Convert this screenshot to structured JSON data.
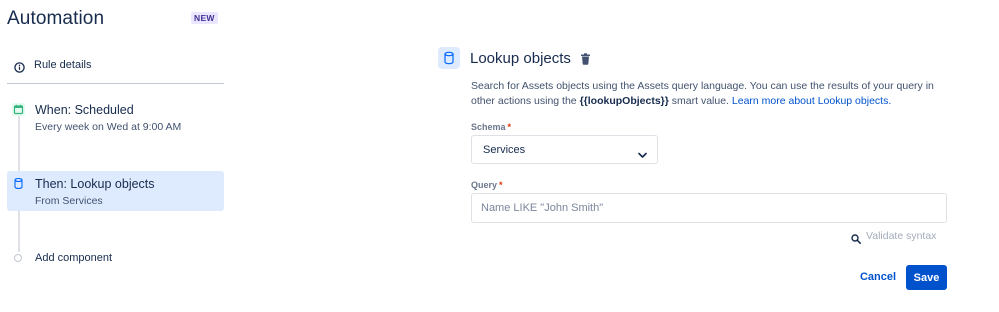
{
  "app": {
    "title": "Automation",
    "badge": "NEW"
  },
  "sidebar": {
    "rule_details": {
      "label": "Rule details",
      "icon": "info-icon"
    },
    "steps": [
      {
        "title": "When: Scheduled",
        "subtitle": "Every week on Wed at 9:00 AM",
        "icon": "calendar-icon",
        "icon_color": "#36b37e"
      },
      {
        "title": "Then: Lookup objects",
        "subtitle": "From Services",
        "icon": "database-icon",
        "icon_color": "#0065ff",
        "selected": true
      }
    ],
    "add_component": {
      "label": "Add component"
    }
  },
  "panel": {
    "title": "Lookup objects",
    "icon": "database-icon",
    "delete_icon": "trash-icon",
    "description": {
      "part1": "Search for Assets objects using the Assets query language. You can use the results of your query in other actions using the ",
      "smart_value": "{{lookupObjects}}",
      "part2": " smart value. ",
      "link": "Learn more about Lookup objects."
    },
    "schema": {
      "label": "Schema",
      "required_mark": "*",
      "value": "Services"
    },
    "query": {
      "label": "Query",
      "required_mark": "*",
      "placeholder": "Name LIKE \"John Smith\"",
      "value": ""
    },
    "validate": {
      "label": "Validate syntax",
      "icon": "search-icon"
    },
    "actions": {
      "cancel": "Cancel",
      "save": "Save"
    }
  },
  "colors": {
    "primary": "#0052cc",
    "selected_bg": "#deebff",
    "text": "#172b4d",
    "subtle_text": "#42526e",
    "required": "#de350b",
    "badge_bg": "#eae6ff",
    "badge_text": "#403294"
  }
}
